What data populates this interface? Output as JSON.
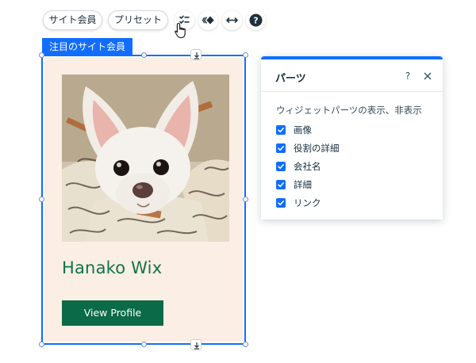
{
  "toolbar": {
    "site_members_label": "サイト会員",
    "preset_label": "プリセット",
    "icons": [
      "layout-icon",
      "animation-icon",
      "stretch-icon",
      "help-icon"
    ],
    "help_glyph": "?"
  },
  "selection": {
    "tag_label": "注目のサイト会員"
  },
  "card": {
    "name": "Hanako Wix",
    "button_label": "View Profile",
    "background_color": "#fbeee4",
    "name_color": "#11744b",
    "button_color": "#0b6a48"
  },
  "panel": {
    "title": "パーツ",
    "help_glyph": "?",
    "subtitle": "ウィジェットパーツの表示、非表示",
    "options": [
      {
        "label": "画像",
        "checked": true
      },
      {
        "label": "役割の詳細",
        "checked": true
      },
      {
        "label": "会社名",
        "checked": true
      },
      {
        "label": "詳細",
        "checked": true
      },
      {
        "label": "リンク",
        "checked": true
      }
    ]
  },
  "colors": {
    "accent": "#116dff"
  }
}
